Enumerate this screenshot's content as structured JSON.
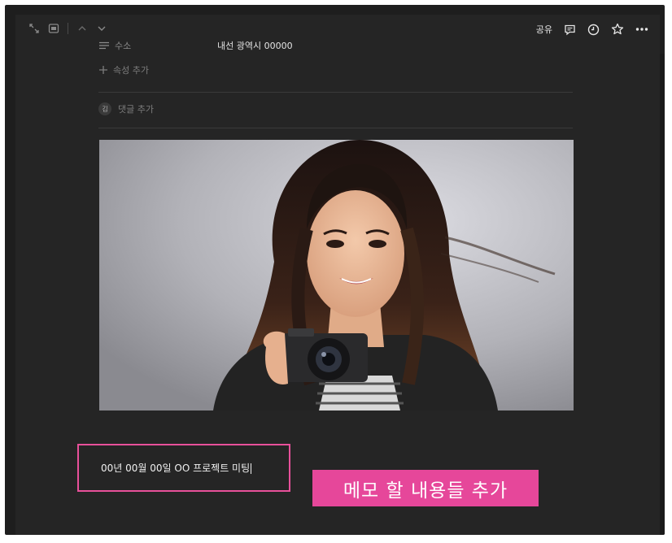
{
  "toolbar": {
    "share_label": "공유",
    "icons": [
      "expand-icon",
      "page-icon",
      "chevron-up-icon",
      "chevron-down-icon",
      "comment-icon",
      "clock-icon",
      "star-icon",
      "more-icon"
    ]
  },
  "properties": {
    "address": {
      "label": "수소",
      "value": "내선 광역시 00000"
    },
    "add_property_label": "속성 추가"
  },
  "comment": {
    "avatar_initial": "김",
    "placeholder": "댓글 추가"
  },
  "memo": {
    "text": "00년 00월 00일 OO 프로젝트 미팅"
  },
  "callout": {
    "text": "메모 할 내용들 추가"
  },
  "colors": {
    "background": "#252525",
    "highlight": "#e6479a"
  }
}
